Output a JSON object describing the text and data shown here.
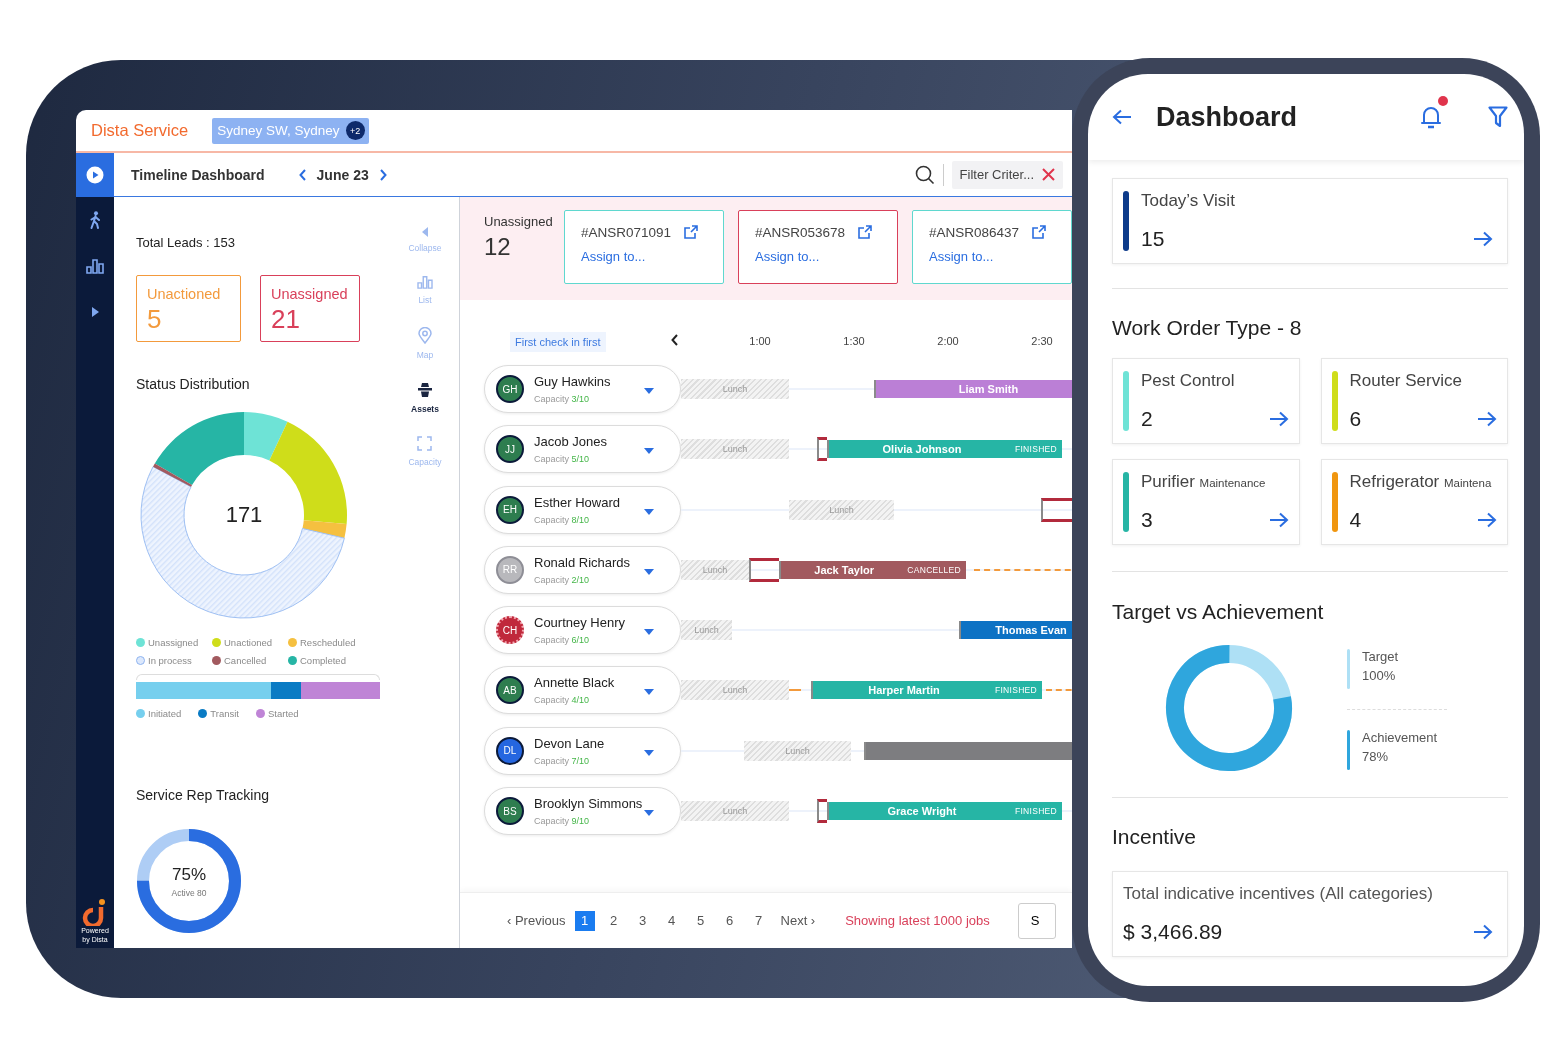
{
  "desktop": {
    "brand": "Dista Service",
    "location_chip": {
      "label": "Sydney SW, Sydney",
      "badge": "+2"
    },
    "sidebar": {
      "items": [
        {
          "kind": "play",
          "selected": true
        },
        {
          "kind": "walk",
          "selected": false
        },
        {
          "kind": "chart",
          "selected": false
        },
        {
          "kind": "expand",
          "selected": false
        }
      ],
      "powered_by": [
        "Powered",
        "by Dista"
      ]
    },
    "header": {
      "title": "Timeline Dashboard",
      "date": "June 23",
      "filter": "Filter Criter..."
    },
    "summary": {
      "total_leads": "Total Leads : 153",
      "cards": [
        {
          "label": "Unactioned",
          "value": "5",
          "color": "#f39a3c"
        },
        {
          "label": "Unassigned",
          "value": "21",
          "color": "#d9405a"
        }
      ]
    },
    "status_distribution": {
      "title": "Status Distribution",
      "total": "171",
      "legend": [
        {
          "label": "Unassigned",
          "color": "#6ee3d6",
          "kind": "solid"
        },
        {
          "label": "Unactioned",
          "color": "#cfdd1a",
          "kind": "solid"
        },
        {
          "label": "Rescheduled",
          "color": "#f5c040",
          "kind": "solid"
        },
        {
          "label": "In process",
          "color": "#dce8fc",
          "kind": "hatched"
        },
        {
          "label": "Cancelled",
          "color": "#a25a5f",
          "kind": "solid"
        },
        {
          "label": "Completed",
          "color": "#26b5a5",
          "kind": "solid"
        }
      ],
      "progress": [
        {
          "label": "Initiated",
          "color": "#76cfee"
        },
        {
          "label": "Transit",
          "color": "#0a7bc4"
        },
        {
          "label": "Started",
          "color": "#bf84d6"
        }
      ]
    },
    "tools": [
      {
        "label": "Collapse",
        "kind": "collapse",
        "selected": false
      },
      {
        "label": "List",
        "kind": "list",
        "selected": false
      },
      {
        "label": "Map",
        "kind": "map",
        "selected": false
      },
      {
        "label": "Assets",
        "kind": "assets",
        "selected": true
      },
      {
        "label": "Capacity",
        "kind": "capacity",
        "selected": false
      }
    ],
    "rep_tracking": {
      "title": "Service Rep Tracking",
      "percent": "75%",
      "caption": "Active 80",
      "level": 0.75
    },
    "timeline": {
      "unassigned": {
        "label": "Unassigned",
        "count": "12",
        "tickets": [
          {
            "id": "#ANSR071091",
            "action": "Assign to...",
            "color": "#5fd8cf"
          },
          {
            "id": "#ANSR053678",
            "action": "Assign to...",
            "color": "#d9405a"
          },
          {
            "id": "#ANSR086437",
            "action": "Assign to...",
            "color": "#5fd8cf"
          }
        ]
      },
      "sort_chip": "First check in first",
      "ticks": [
        "1:00",
        "1:30",
        "2:00",
        "2:30"
      ],
      "rows": [
        {
          "name": "Guy Hawkins",
          "initials": "GH",
          "color": "#2e7d4f",
          "capacity_label": "Capacity",
          "capacity": "3/10",
          "lunch": "Lunch",
          "job": {
            "name": "Liam Smith",
            "color": "#bb7fd6"
          }
        },
        {
          "name": "Jacob Jones",
          "initials": "JJ",
          "color": "#2e7d4f",
          "capacity_label": "Capacity",
          "capacity": "5/10",
          "lunch": "Lunch",
          "job": {
            "name": "Olivia Johnson",
            "status": "FINISHED",
            "color": "#26b5a5"
          }
        },
        {
          "name": "Esther Howard",
          "initials": "EH",
          "color": "#2e7d4f",
          "capacity_label": "Capacity",
          "capacity": "8/10",
          "lunch": "Lunch"
        },
        {
          "name": "Ronald Richards",
          "initials": "RR",
          "color": "#b8b8bc",
          "capacity_label": "Capacity",
          "capacity": "2/10",
          "lunch": "Lunch",
          "job": {
            "name": "Jack Taylor",
            "status": "CANCELLED",
            "color": "#a25a5f"
          }
        },
        {
          "name": "Courtney Henry",
          "initials": "CH",
          "color": "#c0283b",
          "capacity_label": "Capacity",
          "capacity": "6/10",
          "lunch": "Lunch",
          "job": {
            "name": "Thomas Evan",
            "color": "#0d72c4"
          }
        },
        {
          "name": "Annette Black",
          "initials": "AB",
          "color": "#2e7d4f",
          "capacity_label": "Capacity",
          "capacity": "4/10",
          "lunch": "Lunch",
          "job": {
            "name": "Harper Martin",
            "status": "FINISHED",
            "color": "#26b5a5"
          }
        },
        {
          "name": "Devon Lane",
          "initials": "DL",
          "color": "#2566e0",
          "capacity_label": "Capacity",
          "capacity": "7/10",
          "lunch": "Lunch",
          "job": {
            "color": "#7d7d80"
          }
        },
        {
          "name": "Brooklyn Simmons",
          "initials": "BS",
          "color": "#2e7d4f",
          "capacity_label": "Capacity",
          "capacity": "9/10",
          "lunch": "Lunch",
          "job": {
            "name": "Grace Wright",
            "status": "FINISHED",
            "color": "#26b5a5"
          }
        }
      ],
      "pagination": {
        "previous": "‹ Previous",
        "pages": [
          {
            "label": "1",
            "selected": true
          },
          {
            "label": "2",
            "selected": false
          },
          {
            "label": "3",
            "selected": false
          },
          {
            "label": "4",
            "selected": false
          },
          {
            "label": "5",
            "selected": false
          },
          {
            "label": "6",
            "selected": false
          },
          {
            "label": "7",
            "selected": false
          }
        ],
        "next": "Next ›",
        "note": "Showing latest 1000 jobs",
        "button": "S"
      }
    }
  },
  "mobile": {
    "title": "Dashboard",
    "notification": true,
    "todays_visit": {
      "label": "Today’s Visit",
      "value": "15",
      "color": "#0d3b8a"
    },
    "work_orders": {
      "title": "Work Order Type - 8",
      "items": [
        {
          "label": "Pest Control",
          "value": "2",
          "color": "#6ee3d6"
        },
        {
          "label": "Router Service",
          "value": "6",
          "color": "#cfdd1a"
        },
        {
          "label": "Purifier",
          "sublabel": "Maintenance",
          "value": "3",
          "color": "#26b5a5"
        },
        {
          "label": "Refrigerator",
          "sublabel": "Maintena",
          "value": "4",
          "color": "#f0960f"
        }
      ]
    },
    "target": {
      "title": "Target vs Achievement",
      "level": 0.78,
      "legend": [
        {
          "label": "Target",
          "value": "100%",
          "color": "#aee0f5"
        },
        {
          "label": "Achievement",
          "value": "78%",
          "color": "#2fa6dd"
        }
      ]
    },
    "incentive": {
      "title": "Incentive",
      "label": "Total indicative incentives",
      "sublabel": "(All categories)",
      "amount": "$ 3,466.89"
    }
  }
}
